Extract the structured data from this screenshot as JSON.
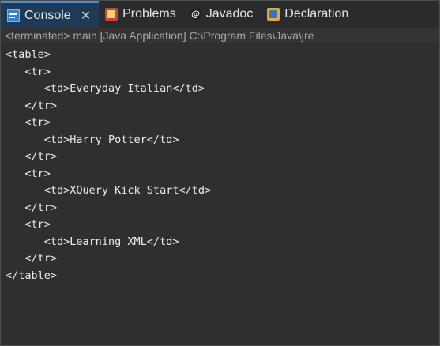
{
  "tabs": [
    {
      "label": "Console",
      "icon": "console-icon",
      "active": true,
      "closable": true
    },
    {
      "label": "Problems",
      "icon": "problems-icon"
    },
    {
      "label": "Javadoc",
      "icon": "javadoc-icon",
      "glyph": "@"
    },
    {
      "label": "Declaration",
      "icon": "declaration-icon"
    }
  ],
  "close_glyph": "✕",
  "status": "<terminated> main [Java Application] C:\\Program Files\\Java\\jre",
  "console": {
    "lines": [
      "<table>",
      "   <tr>",
      "      <td>Everyday Italian</td>",
      "   </tr>",
      "   <tr>",
      "      <td>Harry Potter</td>",
      "   </tr>",
      "   <tr>",
      "      <td>XQuery Kick Start</td>",
      "   </tr>",
      "   <tr>",
      "      <td>Learning XML</td>",
      "   </tr>",
      "</table>"
    ]
  },
  "colors": {
    "active_tab_bg": "#1f3a57",
    "active_tab_accent": "#4b8bd4",
    "console_bg": "#2f2f2f",
    "console_text": "#ebebeb",
    "status_text": "#a9a9a9"
  }
}
